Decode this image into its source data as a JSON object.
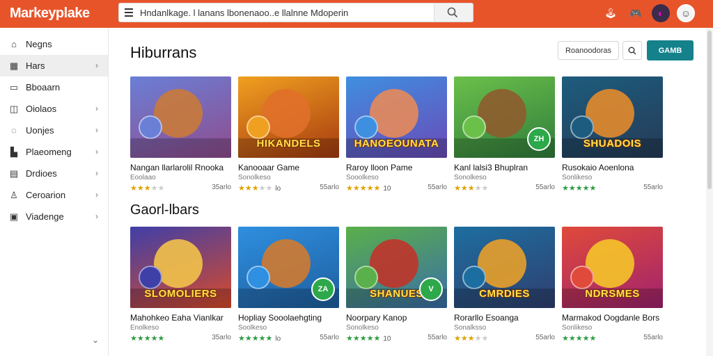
{
  "app": {
    "brand": "Markeyplake"
  },
  "search": {
    "query": "Hndanlkage. l lanans  lbonenaoo..e llalnne  Mdoperin"
  },
  "sidebar": {
    "items": [
      {
        "label": "Negns",
        "icon": "home-icon",
        "chevron": false
      },
      {
        "label": "Hars",
        "icon": "calendar-icon",
        "chevron": true
      },
      {
        "label": "Bboaarn",
        "icon": "tv-icon",
        "chevron": false
      },
      {
        "label": "Oiolaos",
        "icon": "info-icon",
        "chevron": true
      },
      {
        "label": "Uonjes",
        "icon": "chat-icon",
        "chevron": true
      },
      {
        "label": "Plaeomeng",
        "icon": "building-icon",
        "chevron": true
      },
      {
        "label": "Drdioes",
        "icon": "grid-icon",
        "chevron": true
      },
      {
        "label": "Ceroarion",
        "icon": "users-icon",
        "chevron": true
      },
      {
        "label": "Viadenge",
        "icon": "store-icon",
        "chevron": true
      }
    ]
  },
  "header": {
    "title": "Hiburrans",
    "secondary_button": "Roanoodoras",
    "primary_button": "GAMB"
  },
  "section2": {
    "title": "Gaorl-lbars"
  },
  "row1": [
    {
      "title": "Nangan llarlarolil Rnooka",
      "sub": "Eoolaao",
      "rating": 3,
      "green": false,
      "count": "",
      "size": "35arlo",
      "colors": [
        "#6a7fd6",
        "#c97a3a",
        "#8f4c8d"
      ],
      "banner": "",
      "badge": ""
    },
    {
      "title": "Kanooaar Game",
      "sub": "Sonolkeso",
      "rating": 3,
      "green": false,
      "count": "lo",
      "size": "55arlo",
      "colors": [
        "#f0a020",
        "#e0702a",
        "#a63a10"
      ],
      "banner": "HIKANDELS",
      "badge": ""
    },
    {
      "title": "Raroy lloon Pame",
      "sub": "Sooolkeso",
      "rating": 5,
      "green": false,
      "count": "10",
      "size": "55arlo",
      "colors": [
        "#3f8fe0",
        "#e7895a",
        "#6a4ab8"
      ],
      "banner": "HANOEOUNATA",
      "badge": ""
    },
    {
      "title": "Kanl lalsi3 Bhuplran",
      "sub": "Sonolkeso",
      "rating": 3,
      "green": false,
      "count": "",
      "size": "55arlo",
      "colors": [
        "#6bc04a",
        "#8e5c2e",
        "#2f7d3c"
      ],
      "banner": "",
      "badge": "ZH"
    },
    {
      "title": "Rusokaio Aoenlona",
      "sub": "Sonlikeso",
      "rating": 5,
      "green": true,
      "count": "",
      "size": "55arlo",
      "colors": [
        "#1d5c7e",
        "#e38b2c",
        "#253b56"
      ],
      "banner": "SHUADOIS",
      "badge": ""
    }
  ],
  "row2": [
    {
      "title": "Mahohkeo Eaha Vianlkar",
      "sub": "Enolkeso",
      "rating": 5,
      "green": true,
      "count": "",
      "size": "35arlo",
      "colors": [
        "#3f3fa8",
        "#f2c24a",
        "#d84a2a"
      ],
      "banner": "SLOMOLIERS",
      "badge": ""
    },
    {
      "title": "Hopliay Sooolaehgting",
      "sub": "Soolkeso",
      "rating": 5,
      "green": true,
      "count": "lo",
      "size": "55arlo",
      "colors": [
        "#2f8fe0",
        "#d07a30",
        "#1e5e9e"
      ],
      "banner": "",
      "badge": "ZA"
    },
    {
      "title": "Noorpary Kanop",
      "sub": "Sonolkeso",
      "rating": 5,
      "green": true,
      "count": "10",
      "size": "55arlo",
      "colors": [
        "#5ab04a",
        "#c0342a",
        "#3a6ea8"
      ],
      "banner": "SHANUES",
      "badge": "V"
    },
    {
      "title": "Rorarllo Esoanga",
      "sub": "Sonalksso",
      "rating": 3,
      "green": false,
      "count": "",
      "size": "55arlo",
      "colors": [
        "#1d6ea0",
        "#e8a02a",
        "#2f3f6e"
      ],
      "banner": "CMRDIES",
      "badge": ""
    },
    {
      "title": "Marmakod Oogdanle Bors",
      "sub": "Sonlikeso",
      "rating": 5,
      "green": true,
      "count": "",
      "size": "55arlo",
      "colors": [
        "#e04a3a",
        "#f5c42a",
        "#a0226e"
      ],
      "banner": "NDRSMES",
      "badge": ""
    }
  ]
}
